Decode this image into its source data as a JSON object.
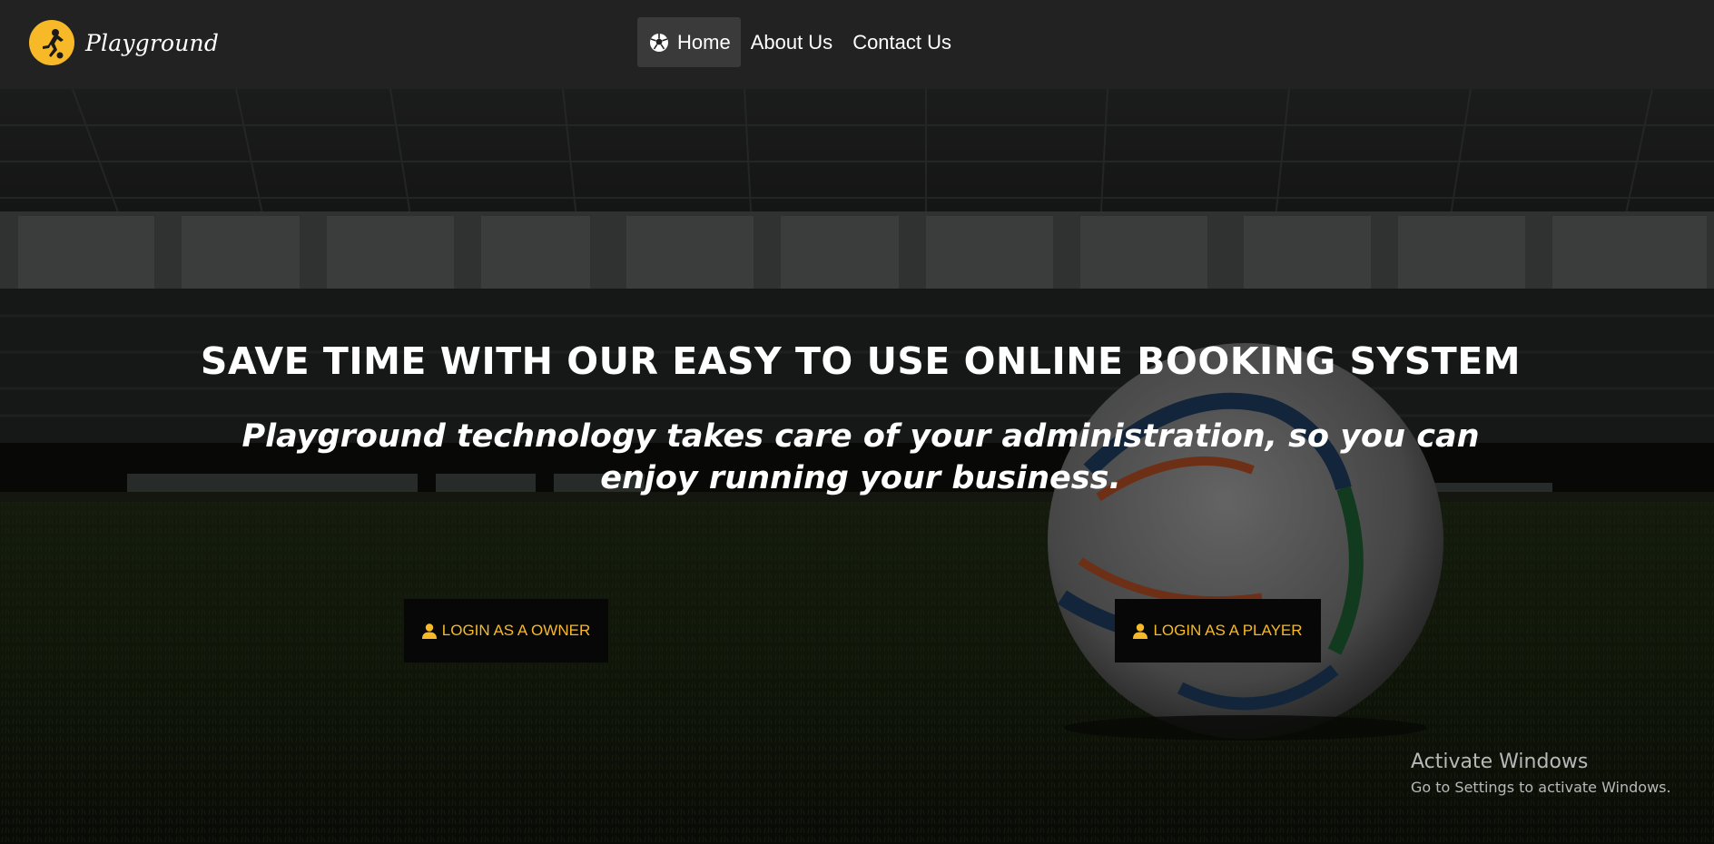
{
  "navbar": {
    "brand_name": "Playground",
    "links": [
      {
        "label": "Home",
        "active": true,
        "icon": "soccer-ball-icon"
      },
      {
        "label": "About Us",
        "active": false
      },
      {
        "label": "Contact Us",
        "active": false
      }
    ]
  },
  "hero": {
    "title": "SAVE TIME WITH OUR EASY TO USE ONLINE BOOKING SYSTEM",
    "subtitle": "Playground technology takes care of your administration, so you can enjoy running your business.",
    "buttons": {
      "owner_label": "LOGIN AS A OWNER",
      "player_label": "LOGIN AS A PLAYER",
      "icon": "user-icon"
    }
  },
  "watermark": {
    "title": "Activate Windows",
    "subtitle": "Go to Settings to activate Windows."
  },
  "colors": {
    "navbar_bg": "#222222",
    "nav_active_bg": "#3a3a3a",
    "accent": "#f7b928",
    "button_bg": "#070707",
    "text": "#ffffff"
  }
}
